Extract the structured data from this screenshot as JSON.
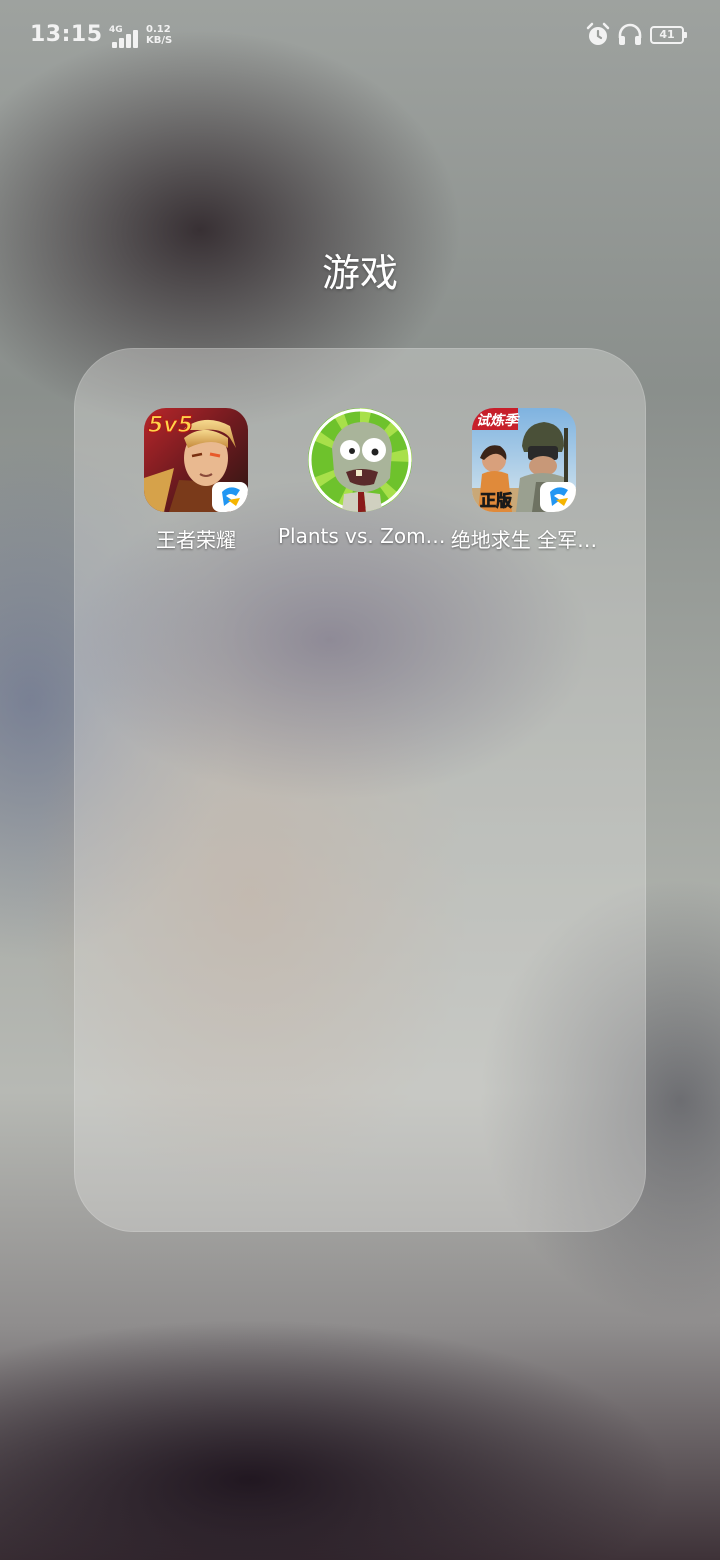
{
  "status_bar": {
    "time": "13:15",
    "network_type": "4G",
    "speed_value": "0.12",
    "speed_unit": "KB/S",
    "battery_level": "41",
    "icons": [
      "signal-icon",
      "alarm-icon",
      "headset-icon",
      "battery-icon"
    ]
  },
  "folder": {
    "title": "游戏",
    "apps": [
      {
        "label": "王者荣耀",
        "icon": "honor-of-kings-icon",
        "badge_text": "5v5"
      },
      {
        "label": "Plants vs. Zom…",
        "icon": "plants-vs-zombies-icon"
      },
      {
        "label": "绝地求生 全军…",
        "icon": "pubg-mobile-icon",
        "badge_text_top": "试炼季",
        "badge_text_bottom": "正版"
      }
    ]
  },
  "colors": {
    "status_text": "#f2f2f2",
    "folder_panel": "rgba(225,226,223,0.38)",
    "label_text": "#ffffff"
  }
}
